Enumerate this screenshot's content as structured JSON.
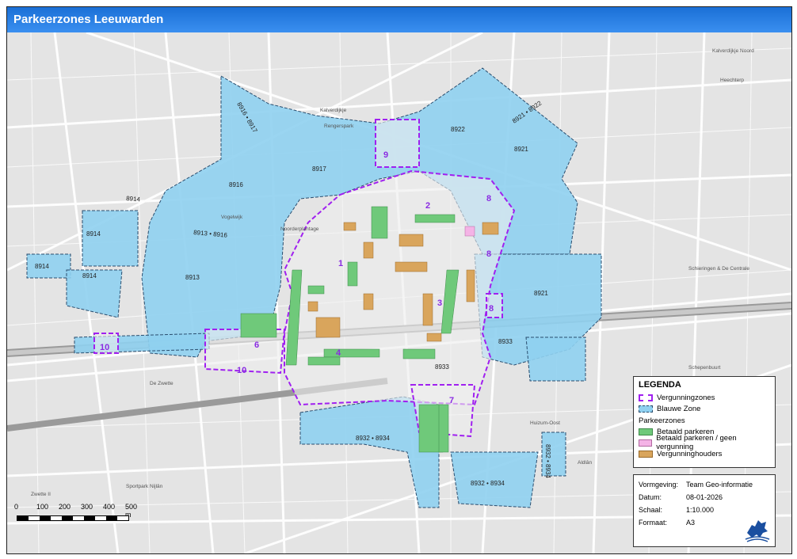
{
  "title": "Parkeerzones Leeuwarden",
  "blue_zone_labels": [
    "8916",
    "8917",
    "8922",
    "8921",
    "8914",
    "8914",
    "8914",
    "8913",
    "8921",
    "8933",
    "8932 • 8934",
    "8932 • 8934",
    "8932 • 8934",
    "8916 • 8917",
    "8913 • 8916",
    "8921 • 8922",
    "8914",
    "8933"
  ],
  "permit_zone_labels": [
    "1",
    "2",
    "3",
    "4",
    "6",
    "7",
    "8",
    "8",
    "8",
    "9",
    "10",
    "10"
  ],
  "street_labels": [
    "Rengerspark",
    "Noorderplantage",
    "Kalverdijkje",
    "Vogelwijk",
    "Heechterp",
    "Schieringen & De Centrale",
    "Schepenbuurt",
    "De Zwette",
    "Huizum-Oost",
    "Aldlân",
    "Sportpark Nijlân",
    "Zwette II",
    "Kalverdijkje Noord"
  ],
  "legend": {
    "title": "LEGENDA",
    "items": [
      {
        "label": "Vergunningzones",
        "color": "#a020f0"
      },
      {
        "label": "Blauwe Zone",
        "color": "#8fd0f0"
      }
    ],
    "subtitle": "Parkeerzones",
    "zones": [
      {
        "label": "Betaald parkeren",
        "color": "#6fc97a"
      },
      {
        "label": "Betaald parkeren / geen vergunning",
        "color": "#f4b3e6"
      },
      {
        "label": "Vergunninghouders",
        "color": "#d9a55c"
      }
    ]
  },
  "metadata": {
    "vormgeving_label": "Vormgeving:",
    "vormgeving": "Team Geo-informatie",
    "datum_label": "Datum:",
    "datum": "08-01-2026",
    "schaal_label": "Schaal:",
    "schaal": "1:10.000",
    "formaat_label": "Formaat:",
    "formaat": "A3"
  },
  "scale": [
    "0",
    "100",
    "200",
    "300",
    "400",
    "500 m"
  ],
  "colors": {
    "blue_zone": "#8fd0f0",
    "permit_border": "#a020f0",
    "paid": "#6fc97a",
    "pink": "#f4b3e6",
    "permit_holders": "#d9a55c",
    "map_bg": "#e4e4e4",
    "road": "#ffffff"
  },
  "icons": [
    "lion-logo-icon"
  ]
}
